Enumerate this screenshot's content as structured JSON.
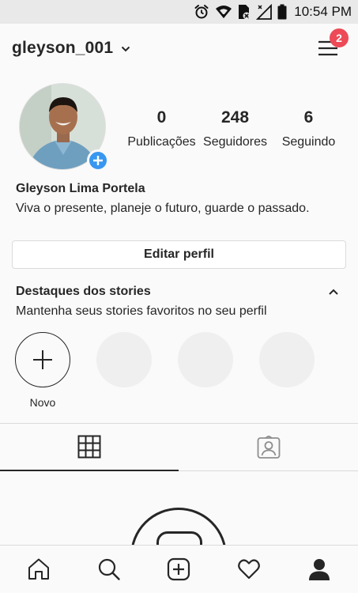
{
  "status_bar": {
    "time": "10:54 PM",
    "icons": [
      "alarm-icon",
      "wifi-icon",
      "signal-icon",
      "battery-icon"
    ]
  },
  "header": {
    "username": "gleyson_001",
    "menu_badge": "2"
  },
  "profile": {
    "stats": [
      {
        "number": "0",
        "label": "Publicações"
      },
      {
        "number": "248",
        "label": "Seguidores"
      },
      {
        "number": "6",
        "label": "Seguindo"
      }
    ],
    "name": "Gleyson Lima Portela",
    "bio": "Viva o presente, planeje o futuro, guarde o passado.",
    "edit_button": "Editar perfil"
  },
  "highlights": {
    "title": "Destaques dos stories",
    "subtitle": "Mantenha seus stories favoritos no seu perfil",
    "new_label": "Novo"
  },
  "tabs": {
    "icons": [
      "grid-icon",
      "tagged-icon"
    ],
    "active": "grid-icon"
  },
  "bottom_nav": {
    "icons": [
      "home-icon",
      "search-icon",
      "new-post-icon",
      "heart-icon",
      "profile-icon"
    ],
    "active": "profile-icon"
  },
  "colors": {
    "accent_blue": "#3897f0",
    "badge_red": "#ed4956",
    "text": "#262626",
    "border": "#dbdbdb"
  }
}
